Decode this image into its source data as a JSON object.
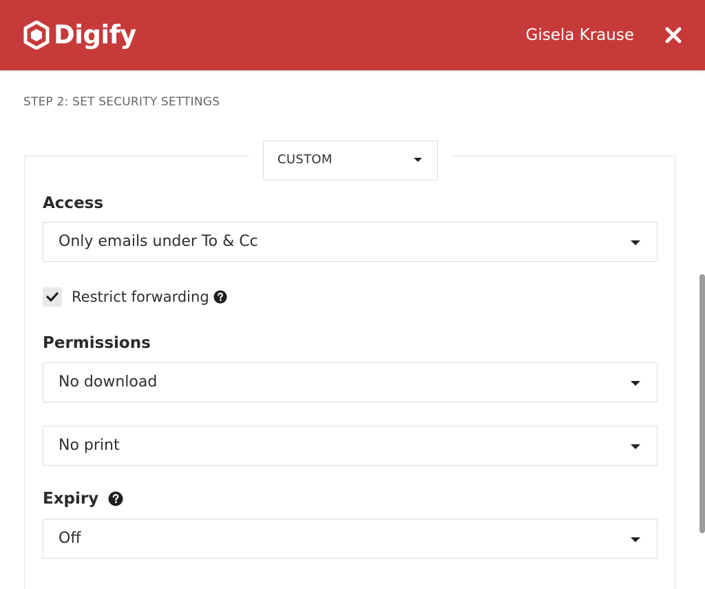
{
  "header": {
    "brand": "Digify",
    "user_name": "Gisela Krause",
    "accent_color": "#c73a3a"
  },
  "step_title": "STEP 2: SET SECURITY SETTINGS",
  "preset": {
    "selected": "CUSTOM"
  },
  "access": {
    "label": "Access",
    "selected": "Only emails under To & Cc"
  },
  "restrict_forwarding": {
    "label": "Restrict forwarding",
    "checked": true
  },
  "permissions": {
    "label": "Permissions",
    "download_selected": "No download",
    "print_selected": "No print"
  },
  "expiry": {
    "label": "Expiry",
    "selected": "Off"
  },
  "icons": {
    "logo": "digify-logo-icon",
    "close": "close-icon",
    "help": "help-icon",
    "check": "checkmark-icon",
    "caret": "caret-down-icon"
  }
}
